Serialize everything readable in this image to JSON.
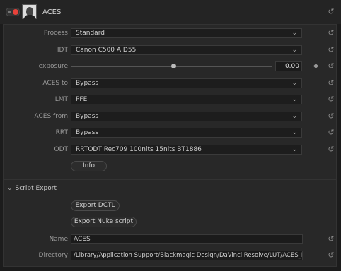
{
  "header": {
    "title": "ACES"
  },
  "rows": {
    "process": {
      "label": "Process",
      "value": "Standard"
    },
    "idt": {
      "label": "IDT",
      "value": "Canon C500 A D55"
    },
    "exposure": {
      "label": "exposure",
      "value": "0.00",
      "slider_level": 0.5
    },
    "aces_to": {
      "label": "ACES to",
      "value": "Bypass"
    },
    "lmt": {
      "label": "LMT",
      "value": "PFE"
    },
    "aces_from": {
      "label": "ACES from",
      "value": "Bypass"
    },
    "rrt": {
      "label": "RRT",
      "value": "Bypass"
    },
    "odt": {
      "label": "ODT",
      "value": "RRTODT Rec709 100nits 15nits BT1886"
    }
  },
  "info_button": "Info",
  "script_export": {
    "title": "Script Export",
    "export_dctl": "Export DCTL",
    "export_nuke": "Export Nuke script",
    "name_label": "Name",
    "name_value": "ACES",
    "directory_label": "Directory",
    "directory_value": "/Library/Application Support/Blackmagic Design/DaVinci Resolve/LUT/ACES_DCTL"
  },
  "colors": {
    "accent": "#e8423a",
    "panel": "#282828",
    "field": "#1d1d1d"
  },
  "icons": [
    "reset-icon",
    "chevron-down-icon",
    "keyframe-diamond-icon",
    "collapse-arrow-icon"
  ]
}
